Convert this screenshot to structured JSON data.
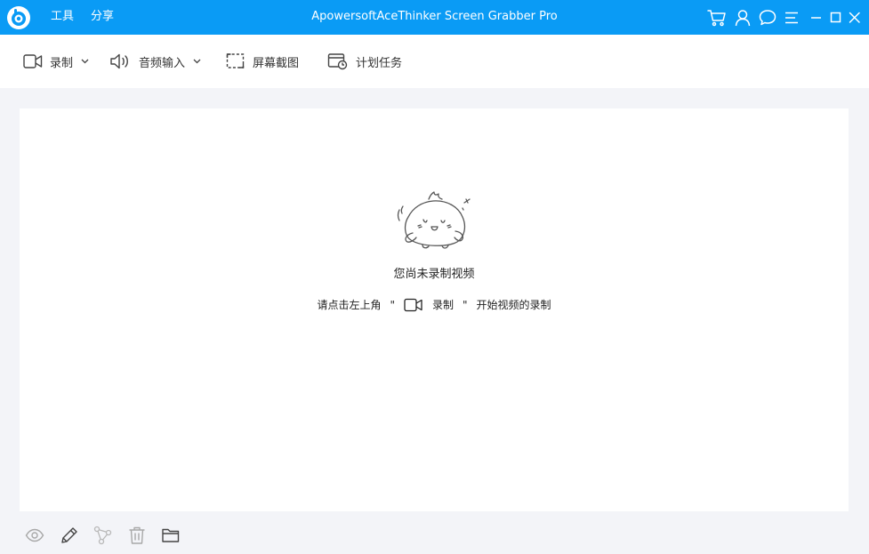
{
  "app": {
    "title": "ApowersoftAceThinker Screen Grabber Pro"
  },
  "menu": {
    "tools_label": "工具",
    "share_label": "分享"
  },
  "titlebar_icons": [
    "cart-icon",
    "user-icon",
    "chat-icon",
    "menu-icon",
    "minimize-icon",
    "maximize-icon",
    "close-icon"
  ],
  "toolbar": {
    "record_label": "录制",
    "audio_input_label": "音频输入",
    "screenshot_label": "屏幕截图",
    "schedule_label": "计划任务"
  },
  "empty_state": {
    "title": "您尚未录制视频",
    "hint_prefix": "请点击左上角",
    "hint_quote_open": "\"",
    "hint_record": "录制",
    "hint_quote_close": "\"",
    "hint_suffix": "开始视频的录制"
  },
  "bottom_icons": [
    "eye-icon",
    "pencil-icon",
    "share-nodes-icon",
    "trash-icon",
    "folder-icon"
  ],
  "colors": {
    "titlebar": "#0a9bf5",
    "toolbar": "#ffffff",
    "background": "#f3f4f8",
    "icon": "#444444",
    "icon_disabled": "#b8b8b8"
  }
}
